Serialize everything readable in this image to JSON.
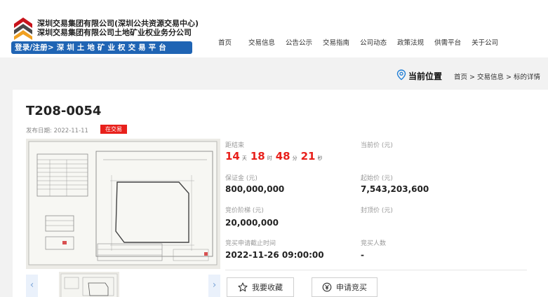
{
  "header": {
    "company_line1": "深圳交易集团有限公司(深圳公共资源交易中心)",
    "company_line2": "深圳交易集团有限公司土地矿业权业务分公司",
    "login_bar": "登录/注册> 深 圳 土 地 矿 业 权 交 易 平 台",
    "nav": [
      "首页",
      "交易信息",
      "公告公示",
      "交易指南",
      "公司动态",
      "政策法规",
      "供需平台",
      "关于公司"
    ]
  },
  "location": {
    "label": "当前位置",
    "breadcrumb": "首页 > 交易信息 > 标的详情"
  },
  "lot": {
    "title": "T208-0054",
    "publish_date": "发布日期: 2022-11-11",
    "status": "在交易"
  },
  "info": {
    "countdown_label": "距结束",
    "countdown": {
      "days": "14",
      "days_unit": "天",
      "hours": "18",
      "hours_unit": "时",
      "minutes": "48",
      "minutes_unit": "分",
      "seconds": "21",
      "seconds_unit": "秒"
    },
    "current_price_label": "当前价 (元)",
    "current_price_value": "",
    "deposit_label": "保证金 (元)",
    "deposit_value": "800,000,000",
    "start_price_label": "起始价 (元)",
    "start_price_value": "7,543,203,600",
    "increment_label": "竞价阶梯 (元)",
    "increment_value": "20,000,000",
    "cap_price_label": "封顶价 (元)",
    "cap_price_value": "",
    "deadline_label": "竞买申请截止时间",
    "deadline_value": "2022-11-26 09:00:00",
    "bidders_label": "竞买人数",
    "bidders_value": "-"
  },
  "gallery": {
    "prev": "‹",
    "next": "›"
  },
  "actions": {
    "favorite": "我要收藏",
    "apply": "申请竞买"
  },
  "colors": {
    "brand_blue": "#1f64b4",
    "accent_red": "#e8201b",
    "logo_orange": "#f0a021",
    "logo_dark": "#4a4a4a"
  }
}
